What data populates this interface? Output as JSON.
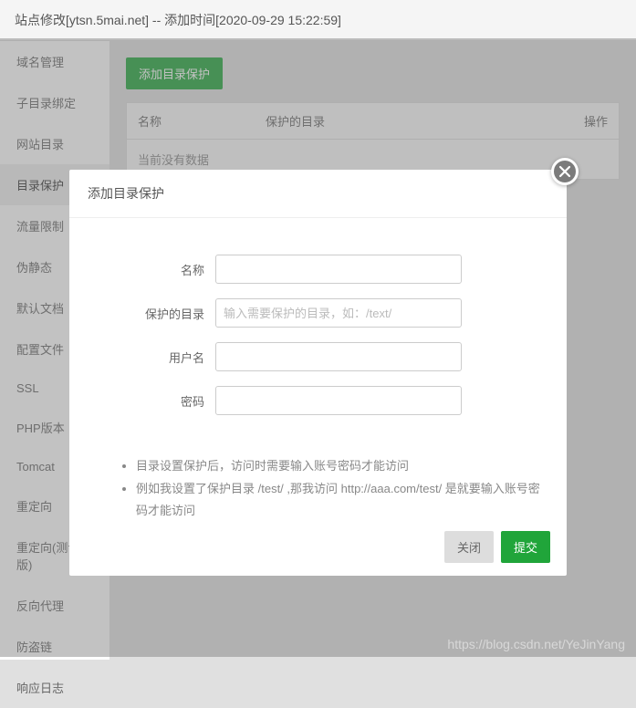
{
  "header": {
    "title": "站点修改[ytsn.5mai.net] -- 添加时间[2020-09-29 15:22:59]"
  },
  "sidebar": {
    "items": [
      {
        "label": "域名管理"
      },
      {
        "label": "子目录绑定"
      },
      {
        "label": "网站目录"
      },
      {
        "label": "目录保护"
      },
      {
        "label": "流量限制"
      },
      {
        "label": "伪静态"
      },
      {
        "label": "默认文档"
      },
      {
        "label": "配置文件"
      },
      {
        "label": "SSL"
      },
      {
        "label": "PHP版本"
      },
      {
        "label": "Tomcat"
      },
      {
        "label": "重定向"
      },
      {
        "label": "重定向(测试版)"
      },
      {
        "label": "反向代理"
      },
      {
        "label": "防盗链"
      },
      {
        "label": "响应日志"
      }
    ],
    "active_index": 3
  },
  "content": {
    "add_button": "添加目录保护",
    "table": {
      "columns": {
        "name": "名称",
        "dir": "保护的目录",
        "op": "操作"
      },
      "empty_text": "当前没有数据"
    }
  },
  "modal": {
    "title": "添加目录保护",
    "fields": {
      "name_label": "名称",
      "dir_label": "保护的目录",
      "dir_placeholder": "输入需要保护的目录，如：/text/",
      "user_label": "用户名",
      "pwd_label": "密码"
    },
    "hints": [
      "目录设置保护后，访问时需要输入账号密码才能访问",
      "例如我设置了保护目录 /test/ ,那我访问 http://aaa.com/test/ 是就要输入账号密码才能访问"
    ],
    "buttons": {
      "close": "关闭",
      "submit": "提交"
    }
  },
  "watermark": "https://blog.csdn.net/YeJinYang"
}
